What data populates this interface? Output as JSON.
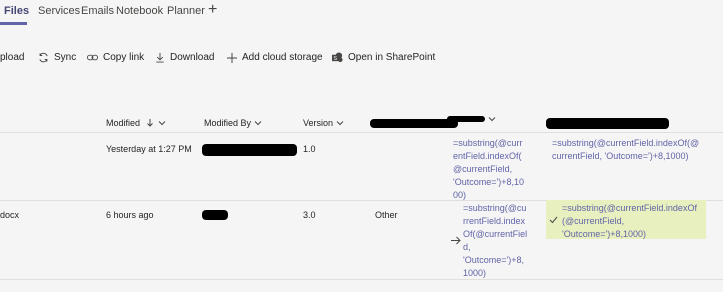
{
  "tabs": [
    {
      "label": "Files",
      "active": true
    },
    {
      "label": "Services",
      "active": false
    },
    {
      "label": "Emails",
      "active": false
    },
    {
      "label": "Notebook",
      "active": false
    },
    {
      "label": "Planner",
      "active": false
    }
  ],
  "add_tab_symbol": "+",
  "toolbar": {
    "upload": "pload",
    "sync": "Sync",
    "copy_link": "Copy link",
    "download": "Download",
    "add_cloud": "Add cloud storage",
    "open_sharepoint": "Open in SharePoint"
  },
  "columns": {
    "modified": "Modified",
    "modified_by": "Modified By",
    "version": "Version"
  },
  "rows": [
    {
      "name": "",
      "modified": "Yesterday at 1:27 PM",
      "version": "1.0",
      "col_a": "",
      "col_b": "=substring(@curr\nentField.indexOf(\n@currentField,\n'Outcome=')+8,10\n00)",
      "col_c": "=substring(@currentField.indexOf(@\ncurrentField, 'Outcome=')+8,1000)"
    },
    {
      "name": "docx",
      "modified": "6 hours ago",
      "version": "3.0",
      "col_a": "Other",
      "col_b": "=substring(@cu\nrrentField.index\nOf(@currentFiel\nd,\n'Outcome=')+8,\n1000)",
      "col_c": "=substring(@currentField.indexOf\n(@currentField,\n'Outcome=')+8,1000)"
    }
  ],
  "colors": {
    "accent": "#6264a7",
    "highlight": "#e8f0c0"
  }
}
